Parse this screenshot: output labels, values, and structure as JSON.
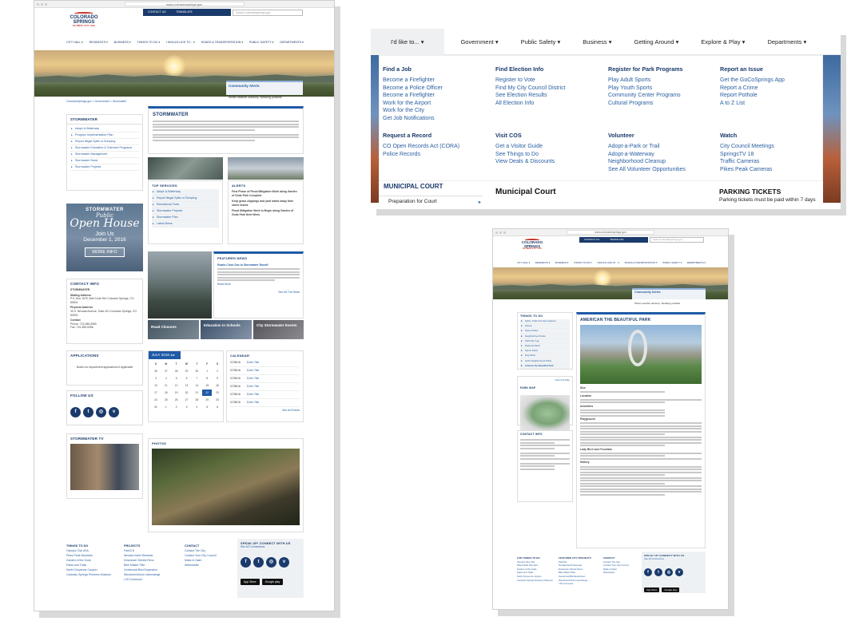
{
  "site": {
    "url": "www.coloradosprings.gov",
    "logo_line1": "COLORADO",
    "logo_line2": "SPRINGS",
    "logo_line3": "OLYMPIC CITY USA",
    "top_links": [
      "CONTACT US",
      "TRANSLATE"
    ],
    "search_placeholder": "Search coloradosprings.gov",
    "nav": [
      "CITY HALL ▾",
      "RESIDENTS ▾",
      "BUSINESS ▾",
      "THINGS TO DO ▾",
      "I WOULD LIKE TO... ▾",
      "ROADS & TRANSPORTATION ▾",
      "PUBLIC SAFETY ▾",
      "DEPARTMENTS ▾"
    ],
    "community_alerts_title": "Community Alerts",
    "community_alerts_text": "Winter weather advisory. Sledding possible."
  },
  "stormwater": {
    "breadcrumb": "ColoradoSprings.gov > Government > Stormwater",
    "sidebar_title": "STORMWATER",
    "sidebar_links": [
      "Adopt-A-Waterway",
      "Program Implementation Plan",
      "Report Illegal Spills or Dumping",
      "Stormwater Education & Outreach Programs",
      "Stormwater Management",
      "Stormwater News",
      "Stormwater Projects"
    ],
    "promo_title": "STORMWATER",
    "promo_script": "Public",
    "promo_big": "Open House",
    "promo_join": "Join Us",
    "promo_date": "December 1, 2016",
    "promo_button": "MORE INFO",
    "contact_title": "CONTACT INFO",
    "contact_name": "STORMWATER",
    "contact_mail_label": "Mailing Address",
    "contact_mail": "P.O. Box 1575, Mail Code 810 Colorado Springs, CO 80901",
    "contact_phys_label": "Physical Address",
    "contact_phys": "30 S. Nevada Avenue, Suite 401 Colorado Springs, CO 80903",
    "contact_label": "Contact",
    "contact_phone": "Phone: 719-385-5980",
    "contact_fax": "Fax: 719-385-5286",
    "applications_title": "APPLICATIONS",
    "applications_text": "Button for department applications if applicable",
    "follow_title": "FOLLOW US",
    "tv_title": "STORMWATER TV",
    "main_title": "STORMWATER",
    "top_services_title": "TOP SERVICES",
    "top_services": [
      "Adopt-A-Waterway",
      "Report Illegal Spills or Dumping",
      "Educational Tools",
      "Stormwater Projects",
      "Stormwater Plan",
      "Latest News"
    ],
    "alerts_title": "ALERTS",
    "alerts": [
      "First Phase of Flood Mitigation Work along Garden of Gods Park Complete",
      "Keep grass clippings and yard waste away from storm drains",
      "Flood Mitigation Work to Begin along Garden of Gods Park Next Week"
    ],
    "featured_title": "FEATURED NEWS",
    "featured_headline": "Roads Close Due to Stormwater Runoff",
    "read_more": "Read More",
    "all_news": "See All The News",
    "tiles": [
      "Road Closures",
      "Education in Schools",
      "City Stormwater Events"
    ],
    "calendar_month": "JULY 2016 ◂ ▸",
    "calendar_title": "CALENDAR",
    "cal_days": [
      "S",
      "M",
      "T",
      "W",
      "T",
      "F",
      "S",
      "26",
      "27",
      "28",
      "29",
      "30",
      "1",
      "2",
      "3",
      "4",
      "5",
      "6",
      "7",
      "8",
      "9",
      "10",
      "11",
      "12",
      "13",
      "14",
      "15",
      "16",
      "17",
      "18",
      "19",
      "20",
      "21",
      "22",
      "23",
      "24",
      "25",
      "26",
      "27",
      "28",
      "29",
      "30",
      "31",
      "1",
      "2",
      "3",
      "4",
      "5",
      "6"
    ],
    "events": [
      {
        "date": "07/28/16",
        "title": "Event Title"
      },
      {
        "date": "07/28/16",
        "title": "Event Title"
      },
      {
        "date": "07/28/16",
        "title": "Event Title"
      },
      {
        "date": "07/28/16",
        "title": "Event Title"
      },
      {
        "date": "07/28/16",
        "title": "Event Title"
      },
      {
        "date": "07/28/16",
        "title": "Event Title"
      }
    ],
    "all_events": "See All Events",
    "photos_title": "PHOTOS",
    "footer_cols": [
      {
        "title": "THINGS TO DO",
        "links": [
          "Olympic City USA",
          "Pikes Peak Mountain",
          "Garden of the Gods",
          "Parks and Trails",
          "North Cheyenne Canyon",
          "Colorado Springs Pioneers Museum"
        ]
      },
      {
        "title": "PROJECTS",
        "links": [
          "Park/CS",
          "Nevada North Renewal",
          "Downtown Streets Reno",
          "Bike Master Plan",
          "Centennial Blvd Expansion",
          "Woodmen/Union Interchange",
          "I-25 Connector"
        ]
      },
      {
        "title": "CONTACT",
        "links": [
          "Contact The City",
          "Contact Your City Council",
          "Make A Claim",
          "Webmaster"
        ]
      }
    ],
    "speak_up": "SPEAK UP! CONNECT WITH US",
    "see_all": "See All Connections",
    "app_store": "App Store",
    "google_play": "Google play"
  },
  "dropdown": {
    "menu": [
      "I'd like to...  ▾",
      "Government  ▾",
      "Public Safety  ▾",
      "Business  ▾",
      "Getting Around  ▾",
      "Explore & Play  ▾",
      "Departments  ▾"
    ],
    "columns": [
      {
        "title": "Find a Job",
        "links": [
          "Become a Firefighter",
          "Become a Police Officer",
          "Become a Firefighter",
          "Work for the Airport",
          "Work for the City",
          "Get Job Notifications"
        ]
      },
      {
        "title": "Find Election Info",
        "links": [
          "Register to Vote",
          "Find My City Council District",
          "See Election Results",
          "All Election Info"
        ]
      },
      {
        "title": "Register for Park Programs",
        "links": [
          "Play Adult Sports",
          "Play Youth Sports",
          "Community Center Programs",
          "Cultural Programs"
        ]
      },
      {
        "title": "Report an Issue",
        "links": [
          "Get the GoCoSprings App",
          "Report a Crime",
          "Report Pothole",
          "A to Z List"
        ]
      },
      {
        "title": "Request a Record",
        "links": [
          "CO Open Records Act (CORA)",
          "Police Records"
        ]
      },
      {
        "title": "Visit COS",
        "links": [
          "Get a Visitor Guide",
          "See Things to Do",
          "View Deals & Discounts"
        ]
      },
      {
        "title": "Volunteer",
        "links": [
          "Adopt-a-Park or Trail",
          "Adopt-a-Waterway",
          "Neighborhood Cleanup",
          "See All Volunteer Opportunities"
        ]
      },
      {
        "title": "Watch",
        "links": [
          "City Council Meetings",
          "SpringsTV 18",
          "Traffic Cameras",
          "Pikes Peak Cameras"
        ]
      }
    ],
    "under_left_title": "MUNICIPAL COURT",
    "under_left_item": "Preparation for Court",
    "under_mid_title": "Municipal Court",
    "under_right_title": "PARKING TICKETS",
    "under_right_text": "Parking tickets must be paid within 7 days"
  },
  "park": {
    "sidebar_title": "THINGS TO DO",
    "sidebar_links": [
      "Parks, Trails and Open Spaces",
      "History",
      "Nature Parks",
      "Neighborhood Parks",
      "Parks By Type",
      "Regional Parks",
      "Sports Parks",
      "Dog Parks",
      "North Neighborhood Parks",
      "America the Beautiful Park"
    ],
    "park_map_title": "PARK MAP",
    "park_map_link": "View Full Map",
    "contact_title": "CONTACT INFO",
    "main_title": "AMERICAN THE BEAUTIFUL PARK",
    "section_labels": [
      "Size",
      "Location",
      "Amenities",
      "Playground",
      "Lady Bird Lane Fountain",
      "History"
    ],
    "footer_cols": [
      {
        "title": "FUN THINGS TO DO",
        "links": [
          "Olympic City USA",
          "Pikes Peak Mountain",
          "Garden of the Gods",
          "Parks and Trails",
          "North Cheyenne Canyon",
          "Colorado Springs Pioneers Museum"
        ]
      },
      {
        "title": "FEATURED CITY PROJECTS",
        "links": [
          "Park/CS",
          "Nevada North Renewal",
          "Downtown Streets Reno",
          "Bike Master Plan",
          "Centennial Blvd Expansion",
          "Woodmen/Union Interchange",
          "I-25 Connector"
        ]
      },
      {
        "title": "CONTACT",
        "links": [
          "Contact The City",
          "Contact Your City Council",
          "Make A Claim",
          "Webmaster"
        ]
      }
    ],
    "speak_up": "SPEAK UP! CONNECT WITH US",
    "see_all": "See All Connections"
  }
}
